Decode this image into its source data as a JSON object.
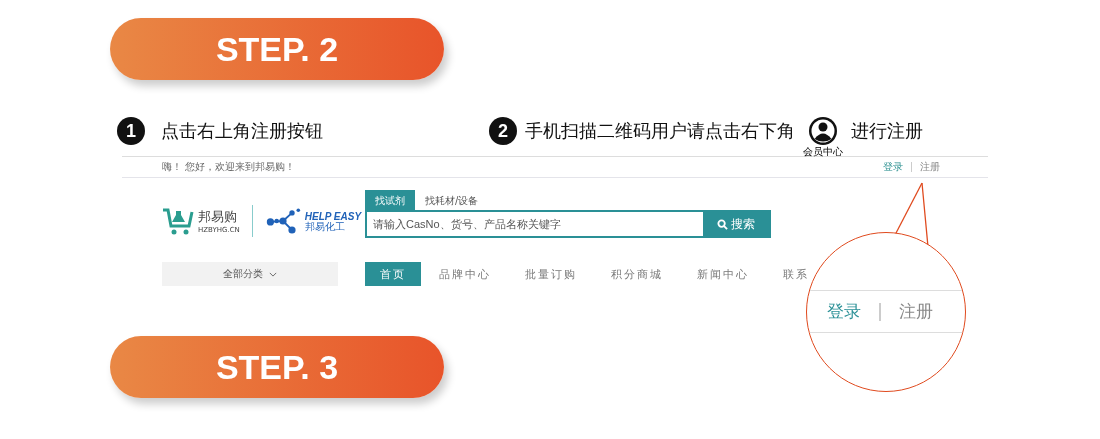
{
  "step_banners": [
    {
      "label": "STEP. 2"
    },
    {
      "label": "STEP. 3"
    }
  ],
  "instructions": [
    {
      "number": "1",
      "text": "点击右上角注册按钮"
    },
    {
      "number": "2",
      "text": "手机扫描二维码用户请点击右下角",
      "icon_caption": "会员中心",
      "text_after": "进行注册"
    }
  ],
  "site": {
    "greeting": "嗨！ 您好，欢迎来到邦易购！",
    "login": "登录",
    "register": "注册",
    "logo": {
      "name": "邦易购",
      "domain": "HZBYHG.CN",
      "partner": "HELP EASY",
      "partner_cn": "邦易化工"
    },
    "search_tabs": [
      {
        "label": "找试剂",
        "selected": true
      },
      {
        "label": "找耗材/设备",
        "selected": false
      }
    ],
    "search": {
      "placeholder": "请输入CasNo、货号、产品名称关键字",
      "button": "搜索"
    },
    "categories": "全部分类",
    "nav": [
      {
        "label": "首页",
        "selected": true
      },
      {
        "label": "品牌中心",
        "selected": false
      },
      {
        "label": "批量订购",
        "selected": false
      },
      {
        "label": "积分商城",
        "selected": false
      },
      {
        "label": "新闻中心",
        "selected": false
      },
      {
        "label": "联系",
        "selected": false
      }
    ]
  },
  "magnifier": {
    "login": "登录",
    "register": "注册"
  }
}
